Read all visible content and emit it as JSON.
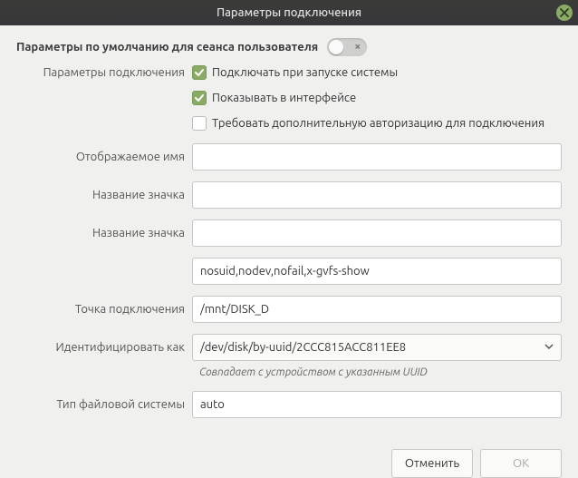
{
  "window": {
    "title": "Параметры подключения"
  },
  "defaults": {
    "label": "Параметры по умолчанию для сеанса пользователя",
    "switch_indicator": "×",
    "switch_on": false
  },
  "labels": {
    "connection_params": "Параметры подключения",
    "display_name": "Отображаемое имя",
    "icon_name": "Название значка",
    "icon_name2": "Название значка",
    "mount_point": "Точка подключения",
    "identify_as": "Идентифицировать как",
    "fs_type": "Тип файловой системы"
  },
  "checkboxes": {
    "mount_at_startup": {
      "label": "Подключать при запуске системы",
      "checked": true
    },
    "show_in_ui": {
      "label": "Показывать в интерфейсе",
      "checked": true
    },
    "require_auth": {
      "label": "Требовать дополнительную авторизацию для подключения",
      "checked": false
    }
  },
  "fields": {
    "display_name": "",
    "icon_name": "",
    "icon_name2": "",
    "options": "nosuid,nodev,nofail,x-gvfs-show",
    "mount_point": "/mnt/DISK_D",
    "identify_as": "/dev/disk/by-uuid/2CCC815ACC811EE8",
    "fs_type": "auto"
  },
  "hint": "Совпадает с устройством с указанным UUID",
  "buttons": {
    "cancel": "Отменить",
    "ok": "OK"
  }
}
